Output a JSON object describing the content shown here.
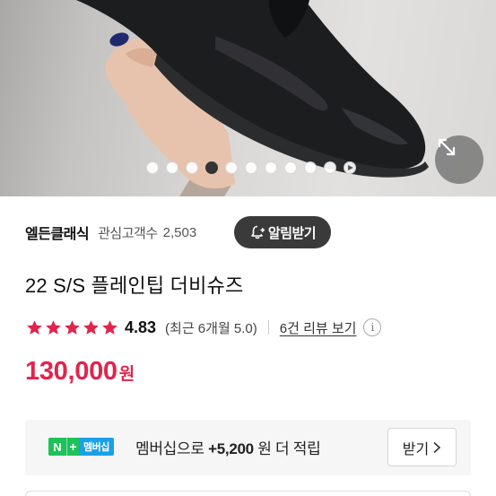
{
  "gallery": {
    "slide_count": 11,
    "active_index": 3,
    "has_play_control": true
  },
  "store": {
    "name": "엘든클래식",
    "fans_label": "관심고객수",
    "fans_count": "2,503",
    "alarm_button_label": "알림받기"
  },
  "product": {
    "title": "22 S/S 플레인팁 더비슈즈"
  },
  "rating": {
    "stars": 5,
    "value": "4.83",
    "recent": "(최근 6개월 5.0)",
    "review_link": "6건 리뷰 보기",
    "info_icon_text": "i"
  },
  "price": {
    "amount": "130,000",
    "unit": "원"
  },
  "membership": {
    "badge_n": "N",
    "badge_plus": "+",
    "badge_label": "멤버십",
    "text_prefix": "멤버십으로",
    "text_amount": "+5,200",
    "text_suffix": "원 더 적립",
    "receive_label": "받기"
  },
  "colors": {
    "accent": "#e1244c",
    "naver_green": "#1fc15a",
    "membership_blue": "#1ba0e8",
    "dark_button": "#3a3a3a"
  },
  "icons": {
    "expand": "expand-arrows-icon",
    "bell": "bell-plus-icon",
    "star": "star-icon",
    "info": "info-icon",
    "chevron": "chevron-right-icon",
    "play": "play-icon"
  }
}
